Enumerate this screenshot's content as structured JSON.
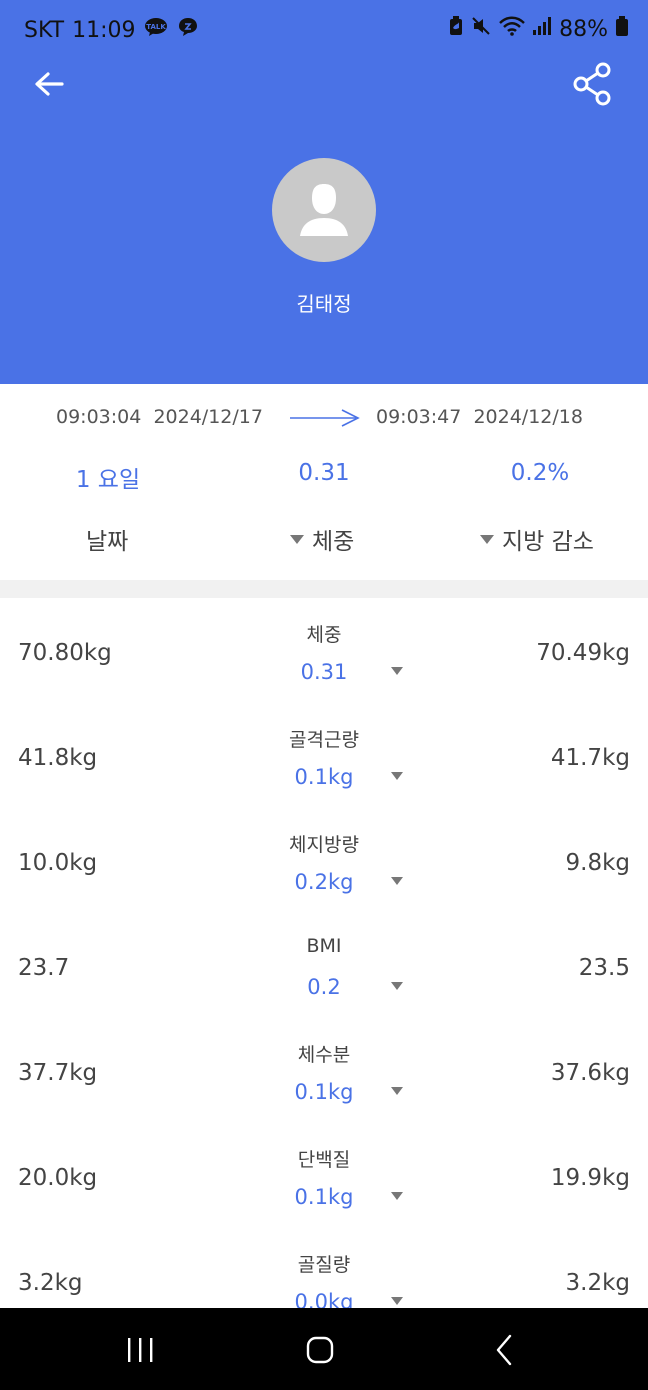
{
  "status_bar": {
    "carrier": "SKT",
    "time": "11:09",
    "battery": "88%",
    "icons": [
      "talk-icon",
      "chat-bubble-icon",
      "battery-saver-icon",
      "mute-icon",
      "wifi-icon",
      "signal-icon",
      "battery-icon"
    ]
  },
  "header": {
    "back_icon": "arrow-left-icon",
    "share_icon": "share-icon",
    "profile_name": "김태정",
    "colors": {
      "accent": "#4a72e6"
    }
  },
  "summary": {
    "start_time": "09:03:04",
    "start_date": "2024/12/17",
    "end_time": "09:03:47",
    "end_date": "2024/12/18",
    "stats": [
      "1 요일",
      "0.31",
      "0.2%"
    ],
    "columns": [
      "날짜",
      "체중",
      "지방 감소"
    ]
  },
  "rows": [
    {
      "left": "70.80kg",
      "label": "체중",
      "diff": "0.31",
      "right": "70.49kg"
    },
    {
      "left": "41.8kg",
      "label": "골격근량",
      "diff": "0.1kg",
      "right": "41.7kg"
    },
    {
      "left": "10.0kg",
      "label": "체지방량",
      "diff": "0.2kg",
      "right": "9.8kg"
    },
    {
      "left": "23.7",
      "label": "BMI",
      "diff": "0.2",
      "right": "23.5"
    },
    {
      "left": "37.7kg",
      "label": "체수분",
      "diff": "0.1kg",
      "right": "37.6kg"
    },
    {
      "left": "20.0kg",
      "label": "단백질",
      "diff": "0.1kg",
      "right": "19.9kg"
    },
    {
      "left": "3.2kg",
      "label": "골질량",
      "diff": "0.0kg",
      "right": "3.2kg"
    }
  ],
  "navbar": {
    "icons": [
      "recents-icon",
      "home-icon",
      "nav-back-icon"
    ]
  }
}
